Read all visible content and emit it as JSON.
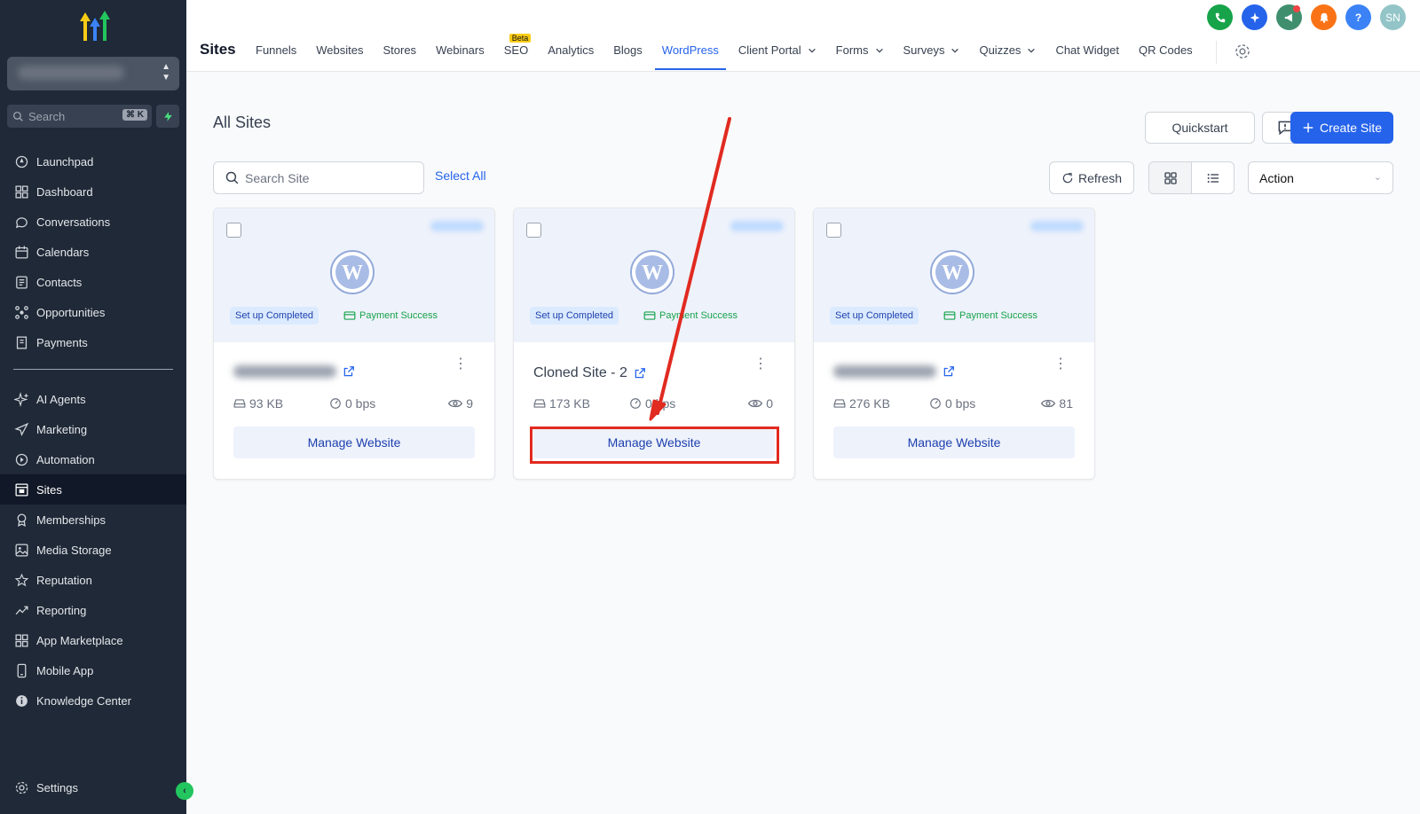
{
  "sidebar": {
    "search_placeholder": "Search",
    "search_shortcut": "⌘ K",
    "items": [
      {
        "label": "Launchpad",
        "icon": "launchpad-icon"
      },
      {
        "label": "Dashboard",
        "icon": "dashboard-icon"
      },
      {
        "label": "Conversations",
        "icon": "chat-icon"
      },
      {
        "label": "Calendars",
        "icon": "calendar-icon"
      },
      {
        "label": "Contacts",
        "icon": "contacts-icon"
      },
      {
        "label": "Opportunities",
        "icon": "opportunities-icon"
      },
      {
        "label": "Payments",
        "icon": "payments-icon"
      },
      {
        "label": "AI Agents",
        "icon": "sparkle-icon"
      },
      {
        "label": "Marketing",
        "icon": "send-icon"
      },
      {
        "label": "Automation",
        "icon": "automation-icon"
      },
      {
        "label": "Sites",
        "icon": "sites-icon"
      },
      {
        "label": "Memberships",
        "icon": "award-icon"
      },
      {
        "label": "Media Storage",
        "icon": "image-icon"
      },
      {
        "label": "Reputation",
        "icon": "star-icon"
      },
      {
        "label": "Reporting",
        "icon": "chart-icon"
      },
      {
        "label": "App Marketplace",
        "icon": "grid-icon"
      },
      {
        "label": "Mobile App",
        "icon": "mobile-icon"
      },
      {
        "label": "Knowledge Center",
        "icon": "info-icon"
      }
    ],
    "settings_label": "Settings",
    "active": "Sites"
  },
  "header": {
    "title": "Sites",
    "tabs": [
      {
        "label": "Funnels"
      },
      {
        "label": "Websites"
      },
      {
        "label": "Stores"
      },
      {
        "label": "Webinars"
      },
      {
        "label": "SEO",
        "badge": "Beta"
      },
      {
        "label": "Analytics"
      },
      {
        "label": "Blogs"
      },
      {
        "label": "WordPress",
        "active": true
      },
      {
        "label": "Client Portal",
        "dropdown": true
      },
      {
        "label": "Forms",
        "dropdown": true
      },
      {
        "label": "Surveys",
        "dropdown": true
      },
      {
        "label": "Quizzes",
        "dropdown": true
      },
      {
        "label": "Chat Widget"
      },
      {
        "label": "QR Codes"
      }
    ],
    "avatar_initials": "SN",
    "help_label": "?"
  },
  "main": {
    "title": "All Sites",
    "quickstart_label": "Quickstart",
    "create_label": "Create Site",
    "search_placeholder": "Search Site",
    "select_all_label": "Select All",
    "refresh_label": "Refresh",
    "action_label": "Action",
    "cards": [
      {
        "name": "",
        "size": "93 KB",
        "bandwidth": "0 bps",
        "views": "9",
        "setup": "Set up Completed",
        "payment": "Payment Success",
        "manage": "Manage Website"
      },
      {
        "name": "Cloned Site - 2",
        "size": "173 KB",
        "bandwidth": "0 bps",
        "views": "0",
        "setup": "Set up Completed",
        "payment": "Payment Success",
        "manage": "Manage Website"
      },
      {
        "name": "",
        "size": "276 KB",
        "bandwidth": "0 bps",
        "views": "81",
        "setup": "Set up Completed",
        "payment": "Payment Success",
        "manage": "Manage Website"
      }
    ]
  },
  "colors": {
    "accent": "#2563eb",
    "sidebar_bg": "#1f2937",
    "annotation": "#e12a20",
    "success": "#16a34a"
  }
}
